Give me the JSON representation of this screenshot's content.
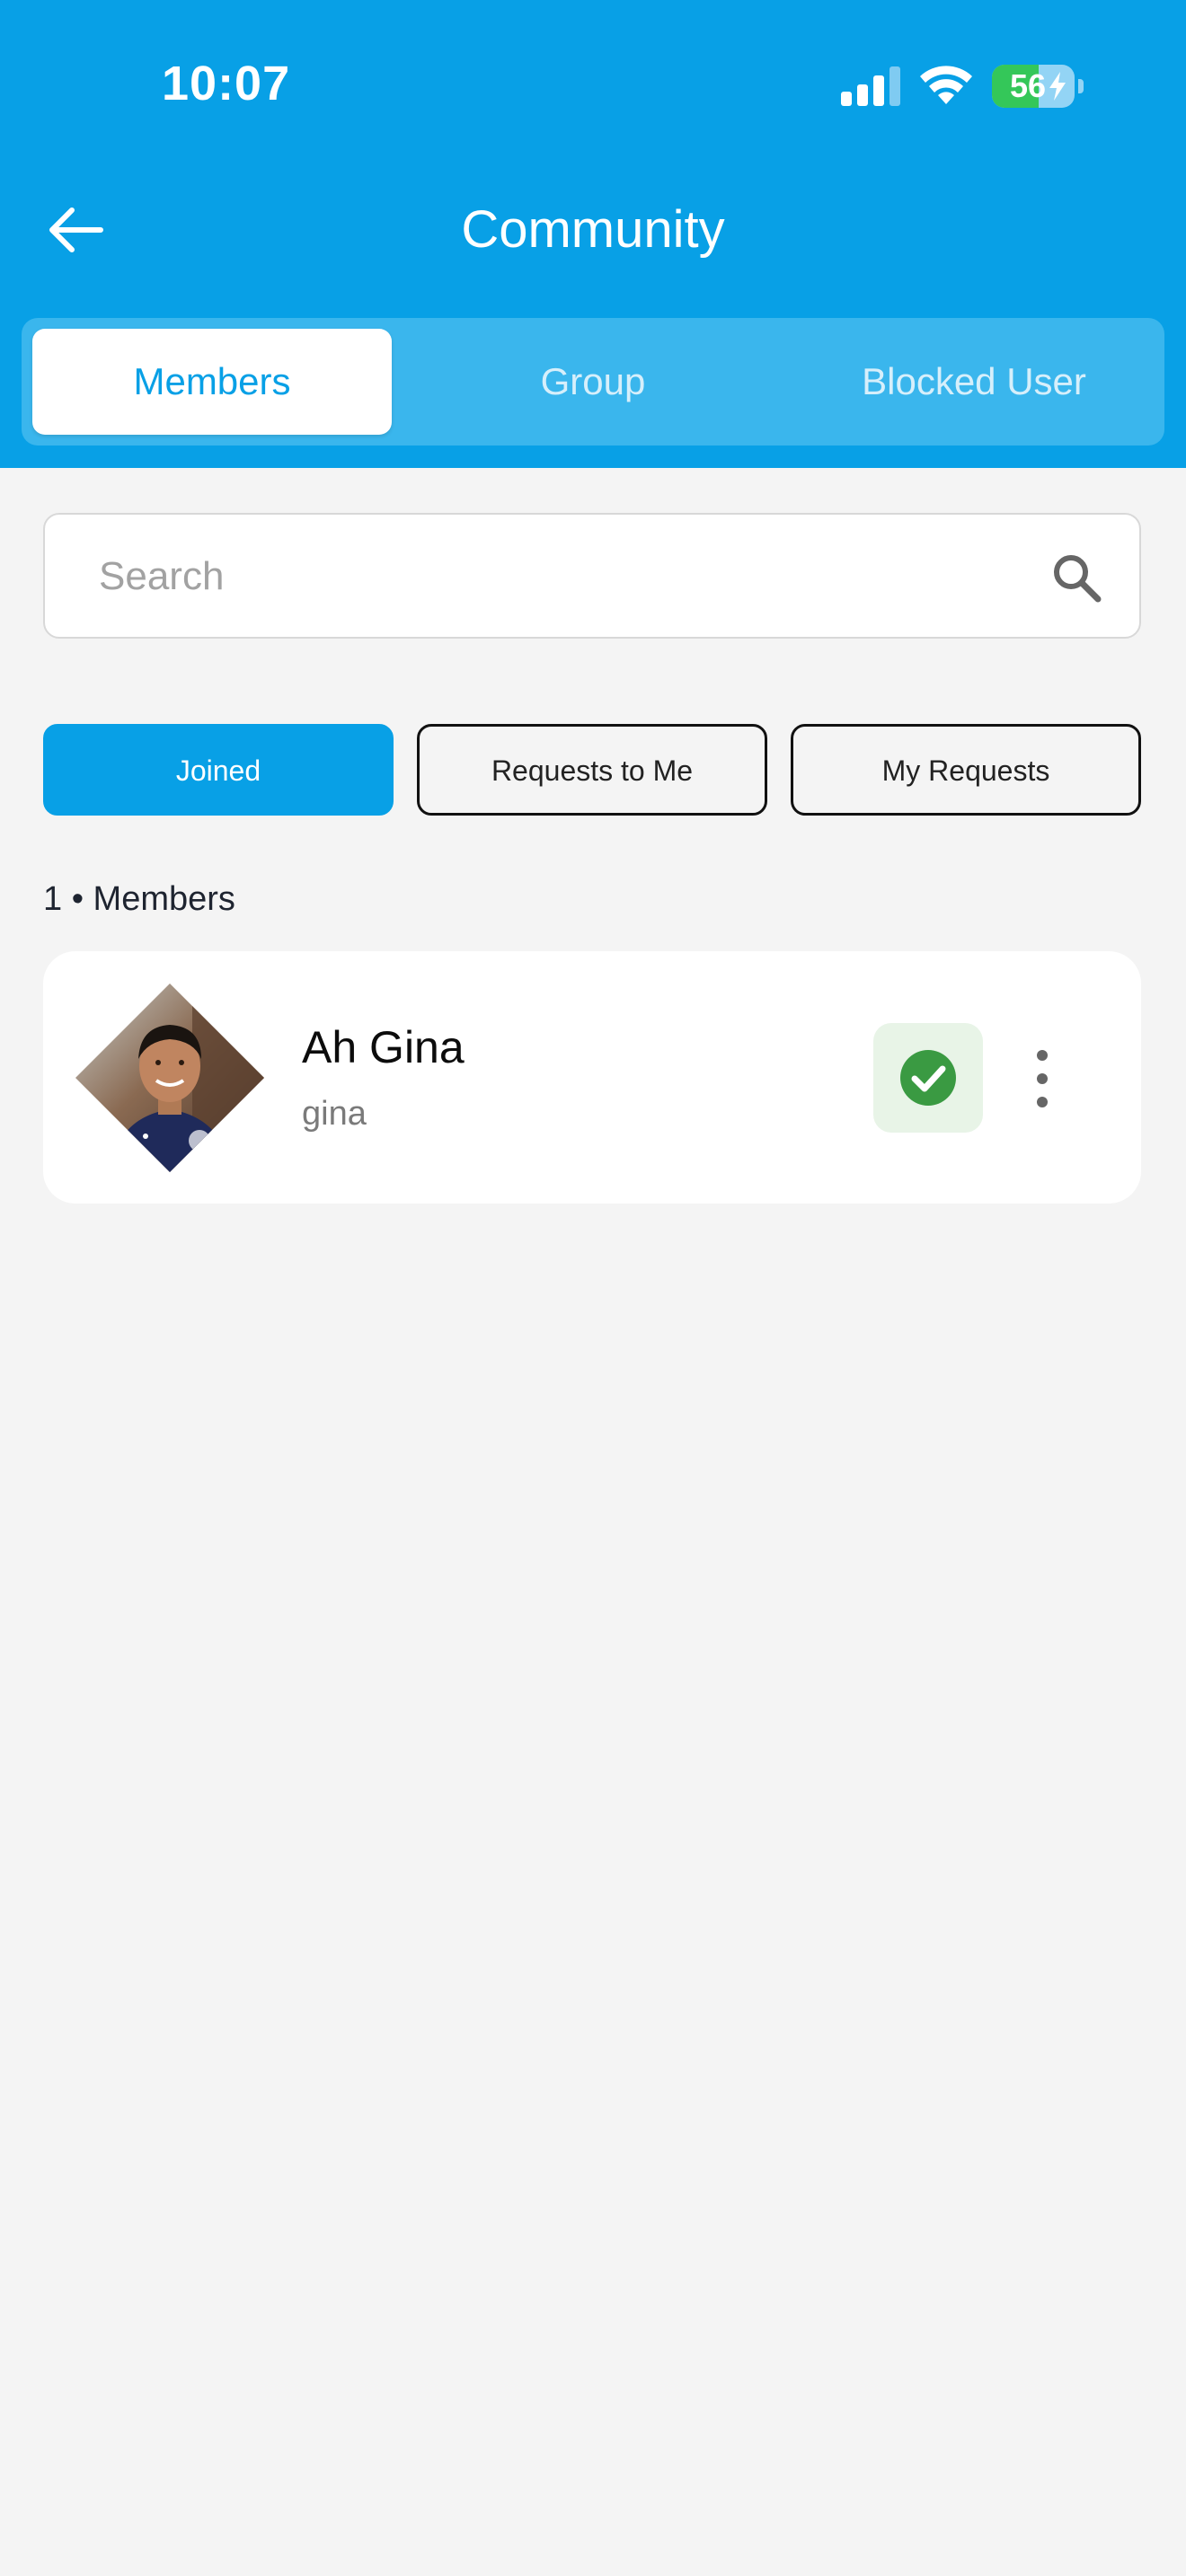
{
  "status_bar": {
    "time": "10:07",
    "battery_level": "56",
    "battery_fraction": 0.56,
    "signal_icon": "cellular-signal-icon",
    "wifi_icon": "wifi-icon",
    "battery_icon": "battery-charging-icon"
  },
  "header": {
    "title": "Community",
    "back_icon": "arrow-left-icon",
    "color": "#08A0E6"
  },
  "tabs": [
    {
      "label": "Members",
      "active": true
    },
    {
      "label": "Group",
      "active": false
    },
    {
      "label": "Blocked User",
      "active": false
    }
  ],
  "search": {
    "placeholder": "Search",
    "value": "",
    "icon": "search-icon"
  },
  "filters": [
    {
      "label": "Joined",
      "active": true
    },
    {
      "label": "Requests to Me",
      "active": false
    },
    {
      "label": "My Requests",
      "active": false
    }
  ],
  "members": {
    "count_label": "1 • Members",
    "items": [
      {
        "name": "Ah Gina",
        "username": "gina",
        "status_icon": "check-circle-icon",
        "status_color": "#3A9A42",
        "menu_icon": "more-vertical-icon"
      }
    ]
  }
}
